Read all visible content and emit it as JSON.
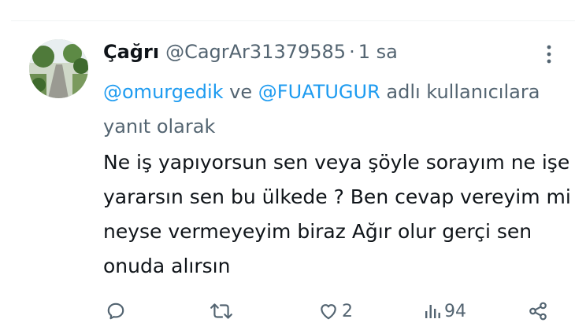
{
  "tweet": {
    "display_name": "Çağrı",
    "handle": "@CagrAr31379585",
    "separator": "·",
    "time": "1 sa",
    "reply_to": {
      "mention_1": "@omurgedik",
      "connector": " ve ",
      "mention_2": "@FUATUGUR",
      "suffix": " adlı kullanıcılara yanıt olarak"
    },
    "text_lines": [
      "Ne iş yapıyorsun sen veya şöyle sorayım ne işe",
      "yararsın sen bu ülkede ? Ben cevap vereyim mi",
      "neyse vermeyeyim biraz Ağır olur gerçi sen",
      "onuda alırsın"
    ]
  },
  "actions": {
    "reply": {
      "icon": "reply-icon",
      "count": ""
    },
    "retweet": {
      "icon": "retweet-icon",
      "count": ""
    },
    "like": {
      "icon": "heart-icon",
      "count": "2"
    },
    "views": {
      "icon": "views-icon",
      "count": "94"
    },
    "share": {
      "icon": "share-icon",
      "count": ""
    }
  },
  "colors": {
    "text": "#0f1419",
    "secondary": "#536471",
    "link": "#1d9bf0",
    "divider": "#eff3f4"
  }
}
